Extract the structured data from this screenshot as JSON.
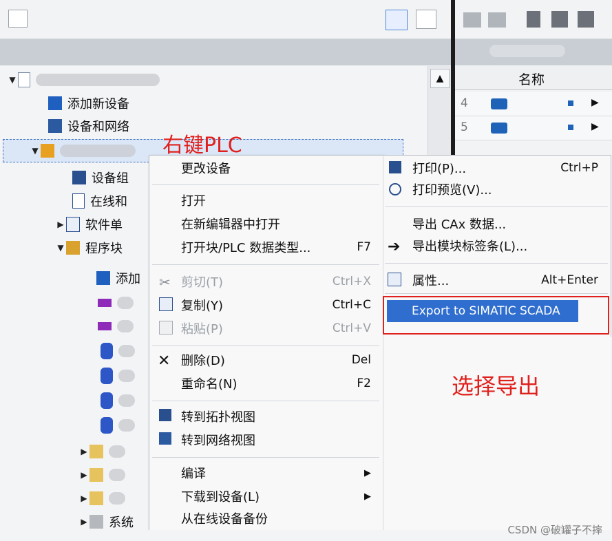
{
  "tree": {
    "items": [
      {
        "label": "添加新设备",
        "indent": 70,
        "icon": "add-device-icon",
        "tri": ""
      },
      {
        "label": "设备和网络",
        "indent": 70,
        "icon": "network-icon",
        "tri": ""
      },
      {
        "label": "设备组",
        "indent": 105,
        "icon": "device-config-icon",
        "tri": ""
      },
      {
        "label": "在线和",
        "indent": 105,
        "icon": "online-diag-icon",
        "tri": ""
      },
      {
        "label": "软件单",
        "indent": 85,
        "icon": "software-unit-icon",
        "tri": "▶"
      },
      {
        "label": "程序块",
        "indent": 85,
        "icon": "program-blocks-icon",
        "tri": "▼"
      },
      {
        "label": "添加",
        "indent": 140,
        "icon": "add-block-icon",
        "tri": ""
      },
      {
        "label": "系统",
        "indent": 120,
        "icon": "system-folder-icon",
        "tri": "▶"
      }
    ]
  },
  "right_panel": {
    "column_name": "名称",
    "rows": [
      "4",
      "5"
    ]
  },
  "annotation": {
    "right_click": "右键PLC",
    "choose_export": "选择导出"
  },
  "context_menu": {
    "items": [
      {
        "label": "更改设备",
        "shortcut": ""
      },
      {
        "label": "打开",
        "shortcut": ""
      },
      {
        "label": "在新编辑器中打开",
        "shortcut": ""
      },
      {
        "label": "打开块/PLC 数据类型...",
        "shortcut": "F7"
      },
      {
        "label": "剪切(T)",
        "shortcut": "Ctrl+X"
      },
      {
        "label": "复制(Y)",
        "shortcut": "Ctrl+C"
      },
      {
        "label": "粘贴(P)",
        "shortcut": "Ctrl+V"
      },
      {
        "label": "删除(D)",
        "shortcut": "Del"
      },
      {
        "label": "重命名(N)",
        "shortcut": "F2"
      },
      {
        "label": "转到拓扑视图",
        "shortcut": ""
      },
      {
        "label": "转到网络视图",
        "shortcut": ""
      },
      {
        "label": "编译",
        "shortcut": "▶"
      },
      {
        "label": "下载到设备(L)",
        "shortcut": "▶"
      },
      {
        "label": "从在线设备备份",
        "shortcut": ""
      }
    ]
  },
  "sub_menu": {
    "items": [
      {
        "label": "打印(P)...",
        "shortcut": "Ctrl+P"
      },
      {
        "label": "打印预览(V)...",
        "shortcut": ""
      },
      {
        "label": "导出 CAx 数据...",
        "shortcut": ""
      },
      {
        "label": "导出模块标签条(L)...",
        "shortcut": ""
      },
      {
        "label": "属性...",
        "shortcut": "Alt+Enter"
      },
      {
        "label": "Export to SIMATIC SCADA",
        "shortcut": ""
      }
    ]
  },
  "watermark": "CSDN @破罐子不摔",
  "colors": {
    "highlight": "#2f6ecf",
    "annotation_red": "#e0201c"
  }
}
